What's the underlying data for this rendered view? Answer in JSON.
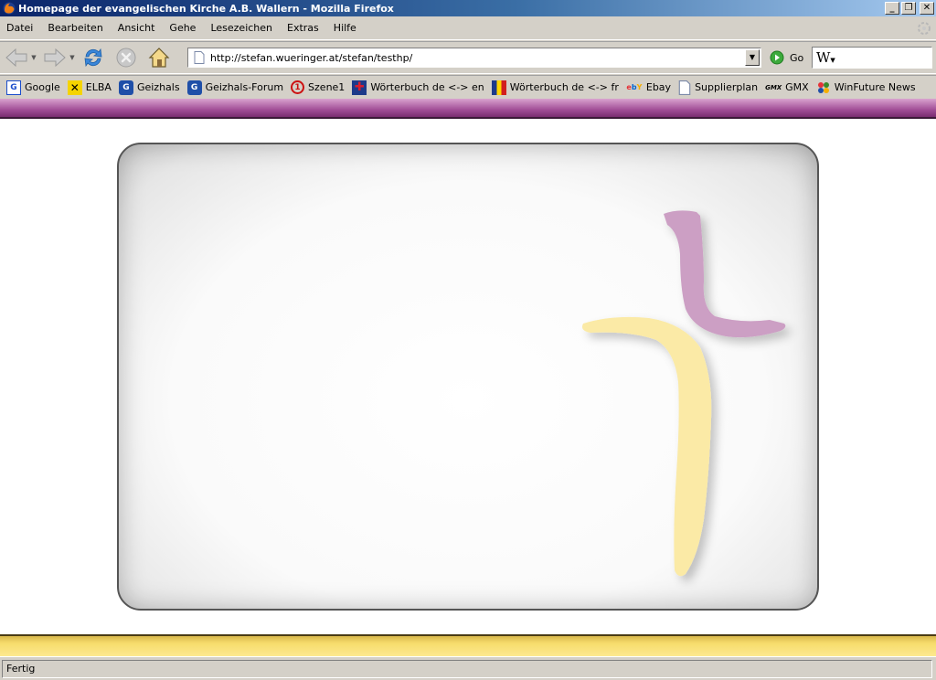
{
  "window": {
    "title": "Homepage der evangelischen Kirche A.B. Wallern - Mozilla Firefox",
    "minimize": "_",
    "maximize": "❐",
    "close": "✕"
  },
  "menu": [
    "Datei",
    "Bearbeiten",
    "Ansicht",
    "Gehe",
    "Lesezeichen",
    "Extras",
    "Hilfe"
  ],
  "navigation": {
    "url": "http://stefan.wueringer.at/stefan/testhp/",
    "go_label": "Go",
    "search_engine_glyph": "W"
  },
  "bookmarks": [
    {
      "label": "Google",
      "icon": "google-icon",
      "glyph": "G",
      "color": "#1a4dcc"
    },
    {
      "label": "ELBA",
      "icon": "raiffeisen-icon",
      "glyph": "✕",
      "color": "#000000"
    },
    {
      "label": "Geizhals",
      "icon": "geizhals-icon",
      "glyph": "G",
      "color": "#1f4fa8"
    },
    {
      "label": "Geizhals-Forum",
      "icon": "geizhals-icon",
      "glyph": "G",
      "color": "#1f4fa8"
    },
    {
      "label": "Szene1",
      "icon": "szene1-icon",
      "glyph": "1",
      "color": "#cc1111"
    },
    {
      "label": "Wörterbuch de <-> en",
      "icon": "uk-flag-icon",
      "glyph": "✚",
      "color": "#b0102a"
    },
    {
      "label": "Wörterbuch de <-> fr",
      "icon": "fr-flag-icon",
      "glyph": "▮",
      "color": "#d21e1e"
    },
    {
      "label": "Ebay",
      "icon": "ebay-icon",
      "glyph": "ebY",
      "color": "#e53238"
    },
    {
      "label": "Supplierplan",
      "icon": "page-icon",
      "glyph": "▯",
      "color": "#6a7fa8"
    },
    {
      "label": "GMX",
      "icon": "gmx-icon",
      "glyph": "GMX",
      "color": "#222222"
    },
    {
      "label": "WinFuture News",
      "icon": "winfuture-icon",
      "glyph": "●",
      "color": "#3a8a2a"
    }
  ],
  "status": {
    "text": "Fertig"
  },
  "colors": {
    "top_band": "#a24e97",
    "bottom_band": "#f6dc6c",
    "cross_vertical": "#fbeaa6",
    "cross_top": "#cc9fc4"
  }
}
